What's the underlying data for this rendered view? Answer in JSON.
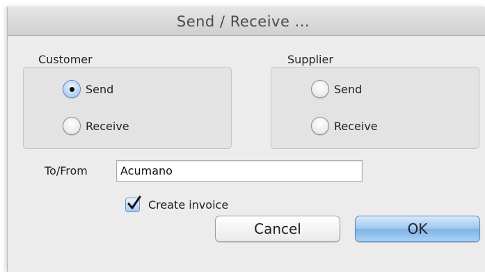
{
  "dialog": {
    "title": "Send / Receive ...",
    "customer": {
      "label": "Customer",
      "options": [
        {
          "label": "Send",
          "selected": true
        },
        {
          "label": "Receive",
          "selected": false
        }
      ]
    },
    "supplier": {
      "label": "Supplier",
      "options": [
        {
          "label": "Send",
          "selected": false
        },
        {
          "label": "Receive",
          "selected": false
        }
      ]
    },
    "to_from": {
      "label": "To/From",
      "value": "Acumano"
    },
    "create_invoice": {
      "label": "Create invoice",
      "checked": true
    },
    "buttons": {
      "cancel": "Cancel",
      "ok": "OK"
    },
    "colors": {
      "accent": "#7fb2e6",
      "window_bg": "#ececec"
    }
  }
}
